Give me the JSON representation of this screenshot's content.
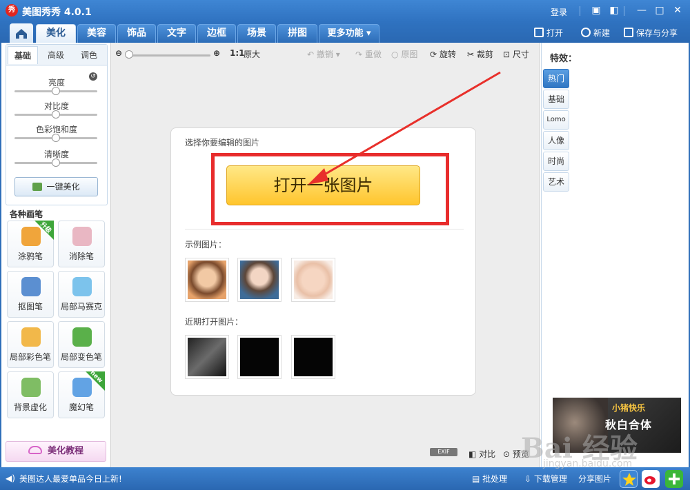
{
  "titlebar": {
    "logo": "秀",
    "title": "美图秀秀 4.0.1",
    "login": "登录",
    "icons": [
      "message-icon",
      "skin-icon",
      "minimize-icon",
      "maximize-icon",
      "close-icon"
    ]
  },
  "tabs": {
    "items": [
      {
        "label": "美化",
        "active": true
      },
      {
        "label": "美容"
      },
      {
        "label": "饰品"
      },
      {
        "label": "文字"
      },
      {
        "label": "边框"
      },
      {
        "label": "场景"
      },
      {
        "label": "拼图"
      },
      {
        "label": "更多功能 ▾"
      }
    ],
    "open": "打开",
    "new": "新建",
    "save": "保存与分享"
  },
  "left": {
    "subtabs": [
      "基础",
      "高级",
      "调色"
    ],
    "sliders": [
      {
        "label": "亮度",
        "value": 0.5
      },
      {
        "label": "对比度",
        "value": 0.5
      },
      {
        "label": "色彩饱和度",
        "value": 0.5
      },
      {
        "label": "清晰度",
        "value": 0.5
      }
    ],
    "onekey": "一键美化",
    "brushes_title": "各种画笔",
    "brushes": [
      {
        "label": "涂鸦笔",
        "badge": "升级",
        "color": "#f0a53b"
      },
      {
        "label": "消除笔",
        "badge": "",
        "color": "#e9b7c3"
      },
      {
        "label": "抠图笔",
        "badge": "",
        "color": "#5b8fd1"
      },
      {
        "label": "局部马赛克",
        "badge": "",
        "color": "#7cc3ec"
      },
      {
        "label": "局部彩色笔",
        "badge": "",
        "color": "#f2b84a"
      },
      {
        "label": "局部变色笔",
        "badge": "",
        "color": "#5ab04a"
      },
      {
        "label": "背景虚化",
        "badge": "",
        "color": "#7fbd64"
      },
      {
        "label": "魔幻笔",
        "badge": "new",
        "color": "#62a3e4"
      }
    ],
    "tutorial": "美化教程"
  },
  "toolbar": {
    "zoom_ratio": "1:1",
    "original_size": "原大",
    "undo": "撤销",
    "redo": "重做",
    "original": "原图",
    "rotate": "旋转",
    "crop": "裁剪",
    "resize": "尺寸"
  },
  "card": {
    "choose_title": "选择你要编辑的图片",
    "open_button": "打开一张图片",
    "samples_title": "示例图片：",
    "recent_title": "近期打开图片："
  },
  "right": {
    "title": "特效：",
    "tabs": [
      "热门",
      "基础",
      "Lomo",
      "人像",
      "时尚",
      "艺术"
    ],
    "ad_text": "秋白合体",
    "ad_sub": "小猪快乐"
  },
  "bottom": {
    "exif": "EXIF",
    "compare": "对比",
    "preview": "预览"
  },
  "status": {
    "text": "美图达人最爱单品今日上新!",
    "batch": "批处理",
    "download": "下载管理",
    "share": "分享图片"
  },
  "watermark": {
    "text": "Bai 经验",
    "url": "jingyan.baidu.com"
  },
  "colors": {
    "accent": "#2f72c0",
    "highlight": "#e82c2c",
    "button_yellow": "#ffc52d"
  }
}
